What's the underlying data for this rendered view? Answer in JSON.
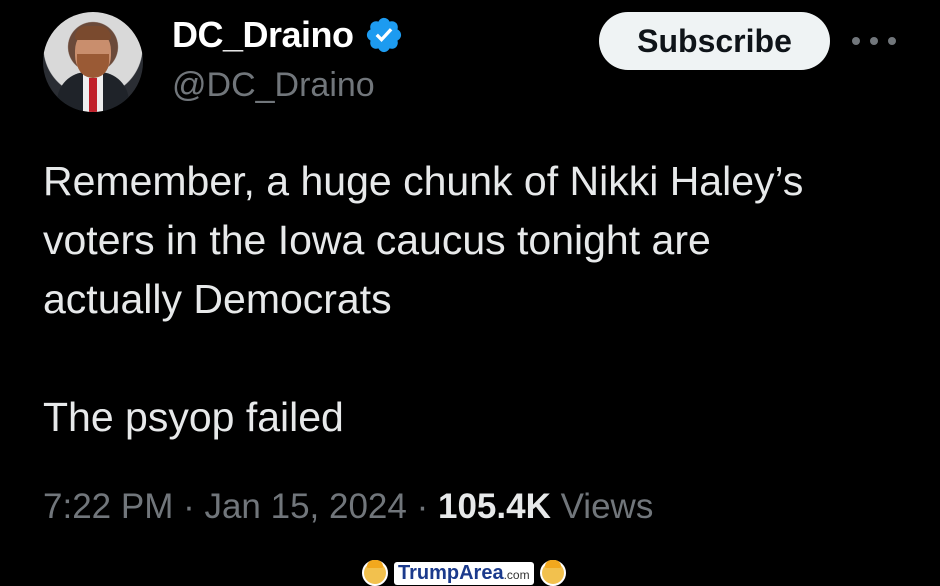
{
  "tweet": {
    "author": {
      "name": "DC_Draino",
      "handle": "@DC_Draino",
      "verified": true
    },
    "subscribe_label": "Subscribe",
    "body_lines": [
      "Remember, a huge chunk of Nikki Haley’s",
      "voters in the Iowa caucus tonight are",
      "actually Democrats"
    ],
    "body_second": "The psyop failed",
    "time": "7:22 PM",
    "separator": " · ",
    "date": "Jan 15, 2024",
    "views_count": "105.4K",
    "views_label": " Views"
  },
  "watermark": {
    "brand": "TrumpArea",
    "tld": ".com"
  },
  "colors": {
    "background": "#000000",
    "text": "#e7e9ea",
    "secondary": "#71767b",
    "verified": "#1d9bf0"
  }
}
